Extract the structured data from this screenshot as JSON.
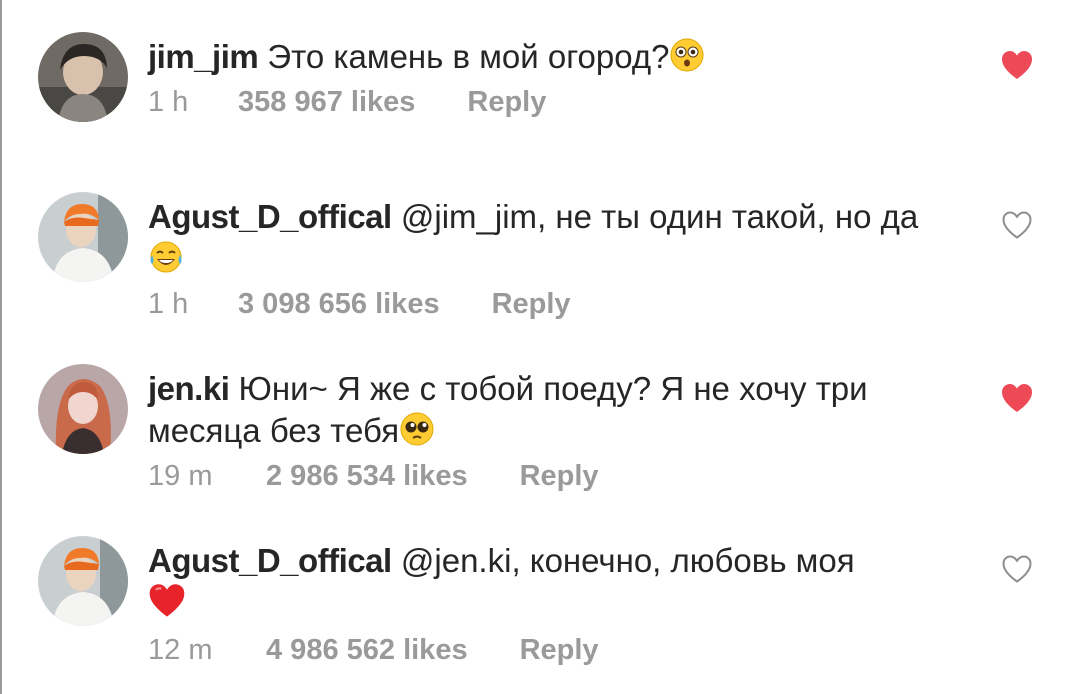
{
  "comments": [
    {
      "username": "jim_jim",
      "text": "Это камень в мой огород?",
      "emoji": "flushed-face",
      "time": "1 h",
      "likes": "358 967 likes",
      "reply": "Reply",
      "liked": true
    },
    {
      "username": "Agust_D_offical",
      "mention": "@jim_jim",
      "text": ", не ты один такой, но да",
      "emoji": "tears-of-joy",
      "time": "1 h",
      "likes": "3 098 656 likes",
      "reply": "Reply",
      "liked": false
    },
    {
      "username": "jen.ki",
      "text": "Юни~ Я же с тобой поеду? Я не хочу три месяца без тебя",
      "emoji": "pleading-face",
      "time": "19 m",
      "likes": "2 986 534 likes",
      "reply": "Reply",
      "liked": true
    },
    {
      "username": "Agust_D_offical",
      "mention": "@jen.ki",
      "text": ", конечно, любовь моя",
      "emoji": "red-heart",
      "time": "12 m",
      "likes": "4 986 562 likes",
      "reply": "Reply",
      "liked": false
    }
  ],
  "colors": {
    "text": "#262626",
    "meta": "#9a9a9a",
    "like_red": "#ed4956",
    "like_outline": "#8e8e8e"
  }
}
